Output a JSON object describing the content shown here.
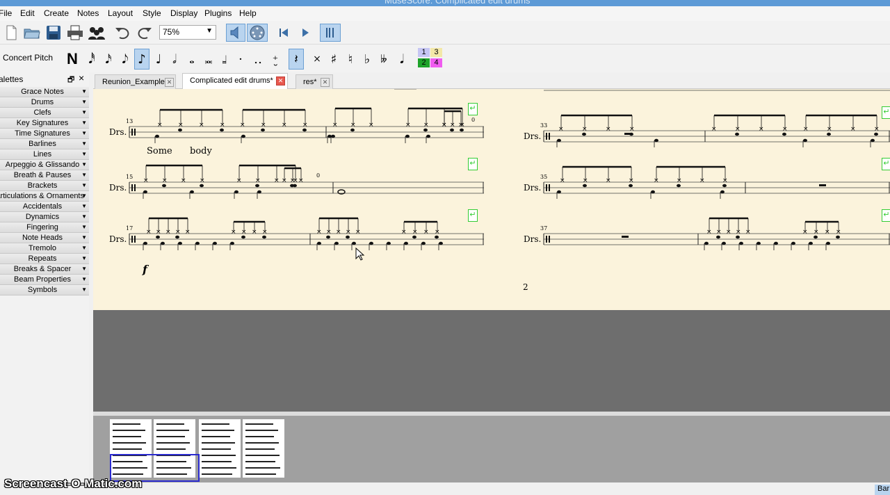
{
  "window": {
    "title": "MuseScore: Complicated edit drums"
  },
  "menu": [
    "File",
    "Edit",
    "Create",
    "Notes",
    "Layout",
    "Style",
    "Display",
    "Plugins",
    "Help"
  ],
  "toolbar": {
    "zoom_value": "75%"
  },
  "note_toolbar": {
    "concert_pitch": "Concert Pitch",
    "note_input_label": "N",
    "voices": [
      "1",
      "3",
      "2",
      "4"
    ],
    "voice_colors": {
      "1": "#c6c6f3",
      "2": "#1ea32a",
      "3": "#f3e8a8",
      "4": "#f05cf0"
    }
  },
  "palettes": {
    "title": "alettes",
    "items": [
      "Grace Notes",
      "Drums",
      "Clefs",
      "Key Signatures",
      "Time Signatures",
      "Barlines",
      "Lines",
      "Arpeggio & Glissando",
      "Breath & Pauses",
      "Brackets",
      "Articulations & Ornaments",
      "Accidentals",
      "Dynamics",
      "Fingering",
      "Note Heads",
      "Tremolo",
      "Repeats",
      "Breaks & Spacer",
      "Beam Properties",
      "Symbols"
    ]
  },
  "tabs": [
    {
      "label": "Reunion_Example",
      "active": false
    },
    {
      "label": "Complicated edit drums*",
      "active": true
    },
    {
      "label": "res*",
      "active": false
    }
  ],
  "score": {
    "staff_label": "Drs.",
    "measure_numbers": [
      "13",
      "15",
      "17",
      "33",
      "35",
      "37"
    ],
    "lyrics": [
      "Some",
      "body"
    ],
    "dynamic": "f",
    "page_number": "2",
    "tuplet_mark": "0"
  },
  "status": {
    "right_text": "Bar",
    "watermark": "Screencast-O-Matic.com"
  }
}
